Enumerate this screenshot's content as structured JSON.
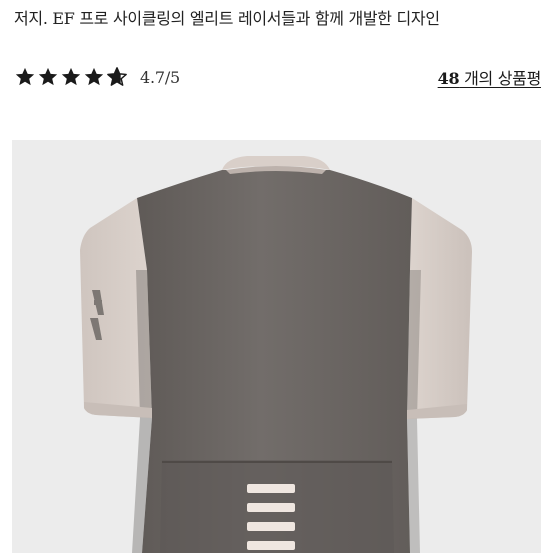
{
  "product": {
    "description": "저지. EF 프로 사이클링의 엘리트 레이서들과 함께 개발한 디자인"
  },
  "rating": {
    "stars_value": 4.7,
    "stars_max": 5,
    "score_text": "4.7/5"
  },
  "reviews": {
    "count": "48",
    "suffix": " 개의 상품평"
  },
  "image": {
    "icon": "cycling-jersey-image",
    "background_color": "#ececec",
    "body_color": "#6f6a67",
    "sleeve_color": "#d9cfc9",
    "stripe_color": "#efe6e0"
  },
  "colors": {
    "star_color": "#1a1a1a",
    "text_color": "#222222"
  }
}
